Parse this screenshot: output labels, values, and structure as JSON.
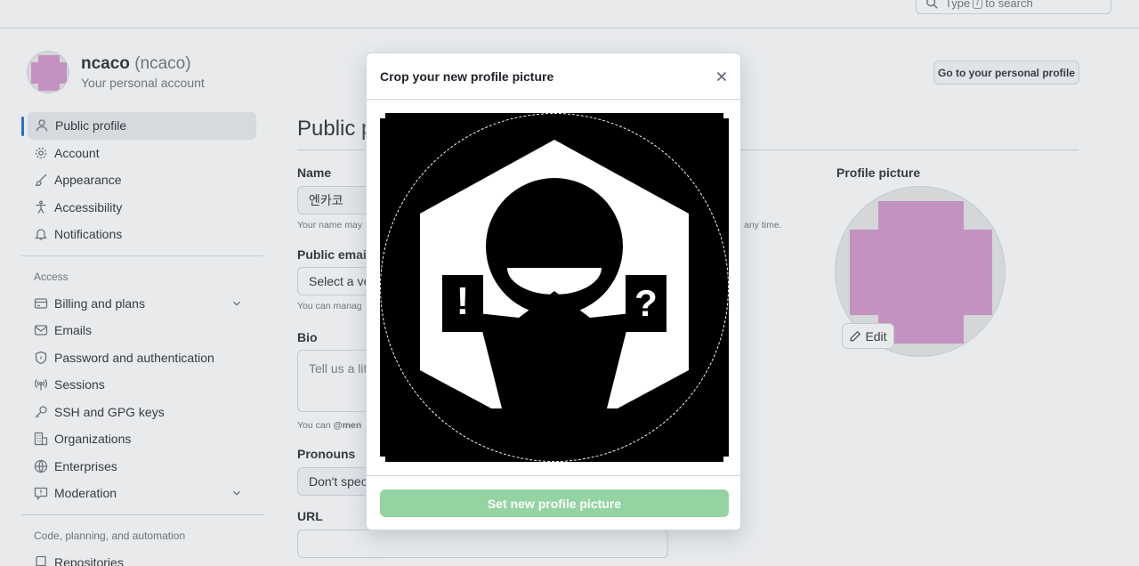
{
  "search": {
    "prefix": "Type",
    "key": "/",
    "suffix": "to search"
  },
  "user": {
    "name": "ncaco",
    "handle": "(ncaco)",
    "subtitle": "Your personal account"
  },
  "header": {
    "go_profile_label": "Go to your personal profile"
  },
  "sidebar": {
    "items": [
      {
        "label": "Public profile",
        "icon": "person-icon"
      },
      {
        "label": "Account",
        "icon": "gear-icon"
      },
      {
        "label": "Appearance",
        "icon": "paintbrush-icon"
      },
      {
        "label": "Accessibility",
        "icon": "accessibility-icon"
      },
      {
        "label": "Notifications",
        "icon": "bell-icon"
      }
    ],
    "access_label": "Access",
    "access_items": [
      {
        "label": "Billing and plans",
        "icon": "credit-card-icon"
      },
      {
        "label": "Emails",
        "icon": "mail-icon"
      },
      {
        "label": "Password and authentication",
        "icon": "shield-lock-icon"
      },
      {
        "label": "Sessions",
        "icon": "broadcast-icon"
      },
      {
        "label": "SSH and GPG keys",
        "icon": "key-icon"
      },
      {
        "label": "Organizations",
        "icon": "organization-icon"
      },
      {
        "label": "Enterprises",
        "icon": "globe-icon"
      },
      {
        "label": "Moderation",
        "icon": "report-icon"
      }
    ],
    "code_label": "Code, planning, and automation",
    "code_items": [
      {
        "label": "Repositories",
        "icon": "repo-icon"
      }
    ]
  },
  "main": {
    "title": "Public p",
    "name_label": "Name",
    "name_value": "엔카코",
    "name_hint": "Your name may",
    "name_hint_tail": "any time.",
    "email_label": "Public email",
    "email_value": "Select a ve",
    "email_hint": "You can manag",
    "bio_label": "Bio",
    "bio_placeholder": "Tell us a litt",
    "bio_hint_prefix": "You can ",
    "bio_hint_bold": "@men",
    "pronouns_label": "Pronouns",
    "pronouns_value": "Don't speci",
    "url_label": "URL",
    "profile_picture_label": "Profile picture",
    "edit_label": "Edit"
  },
  "modal": {
    "title": "Crop your new profile picture",
    "submit_label": "Set new profile picture",
    "image_glyph_left": "!",
    "image_glyph_right": "?"
  },
  "colors": {
    "accent": "#0969da",
    "avatar_pink": "#d391c9",
    "submit_disabled": "#94d3a2"
  }
}
